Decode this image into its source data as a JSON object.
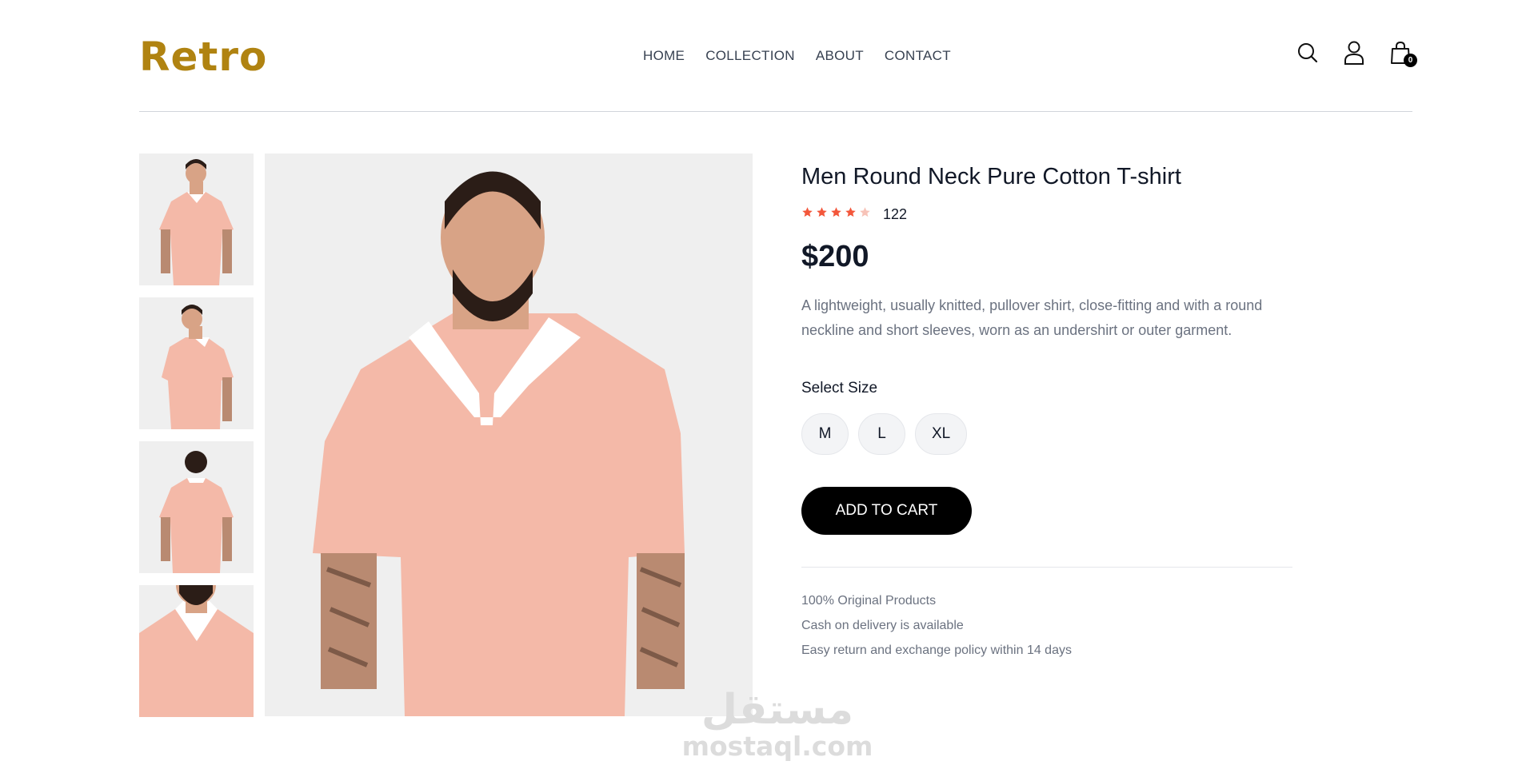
{
  "header": {
    "logo": "Retro",
    "nav": [
      "HOME",
      "COLLECTION",
      "ABOUT",
      "CONTACT"
    ],
    "icons": [
      "search-icon",
      "user-icon",
      "shopping-bag-icon"
    ],
    "cart_count": "0"
  },
  "gallery": {
    "thumbnails": [
      "front view",
      "side view",
      "back view",
      "close-up view"
    ],
    "selected_index": 0
  },
  "product": {
    "title": "Men Round Neck Pure Cotton T-shirt",
    "rating": 4,
    "rating_max": 5,
    "rating_count": "122",
    "price": "$200",
    "description": "A lightweight, usually knitted, pullover shirt, close-fitting and with a round neckline and short sleeves, worn as an undershirt or outer garment.",
    "size_label": "Select Size",
    "sizes": [
      "M",
      "L",
      "XL"
    ],
    "add_to_cart": "ADD TO CART",
    "policies": [
      "100% Original Products",
      "Cash on delivery is available",
      "Easy return and exchange policy within 14 days"
    ]
  },
  "watermark": {
    "arabic": "مستقل",
    "latin": "mostaql.com"
  },
  "colors": {
    "brand": "#b08311",
    "star": "#f3573b",
    "star_empty": "#f7c3b8",
    "shirt": "#f4b9a8",
    "button": "#000000"
  }
}
